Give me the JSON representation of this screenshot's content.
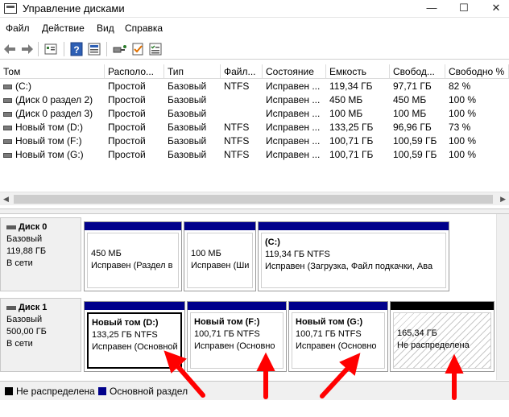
{
  "window": {
    "title": "Управление дисками",
    "minimize": "—",
    "maximize": "☐",
    "close": "✕"
  },
  "menu": [
    "Файл",
    "Действие",
    "Вид",
    "Справка"
  ],
  "toolbar_icons": [
    "back-icon",
    "forward-icon",
    "properties-icon",
    "help-icon",
    "view-icon",
    "connect-icon",
    "check-icon",
    "list-icon"
  ],
  "columns": [
    "Том",
    "Располо...",
    "Тип",
    "Файл...",
    "Состояние",
    "Емкость",
    "Свобод...",
    "Свободно %"
  ],
  "volumes": [
    [
      "(C:)",
      "Простой",
      "Базовый",
      "NTFS",
      "Исправен ...",
      "119,34 ГБ",
      "97,71 ГБ",
      "82 %"
    ],
    [
      "(Диск 0 раздел 2)",
      "Простой",
      "Базовый",
      "",
      "Исправен ...",
      "450 МБ",
      "450 МБ",
      "100 %"
    ],
    [
      "(Диск 0 раздел 3)",
      "Простой",
      "Базовый",
      "",
      "Исправен ...",
      "100 МБ",
      "100 МБ",
      "100 %"
    ],
    [
      "Новый том (D:)",
      "Простой",
      "Базовый",
      "NTFS",
      "Исправен ...",
      "133,25 ГБ",
      "96,96 ГБ",
      "73 %"
    ],
    [
      "Новый том (F:)",
      "Простой",
      "Базовый",
      "NTFS",
      "Исправен ...",
      "100,71 ГБ",
      "100,59 ГБ",
      "100 %"
    ],
    [
      "Новый том (G:)",
      "Простой",
      "Базовый",
      "NTFS",
      "Исправен ...",
      "100,71 ГБ",
      "100,59 ГБ",
      "100 %"
    ]
  ],
  "disks": [
    {
      "name": "Диск 0",
      "type": "Базовый",
      "size": "119,88 ГБ",
      "status": "В сети",
      "partitions": [
        {
          "name": "",
          "size": "450 МБ",
          "status": "Исправен (Раздел в"
        },
        {
          "name": "",
          "size": "100 МБ",
          "status": "Исправен (Ши"
        },
        {
          "name": "(C:)",
          "size": "119,34 ГБ NTFS",
          "status": "Исправен (Загрузка, Файл подкачки, Ава"
        }
      ]
    },
    {
      "name": "Диск 1",
      "type": "Базовый",
      "size": "500,00 ГБ",
      "status": "В сети",
      "partitions": [
        {
          "name": "Новый том  (D:)",
          "size": "133,25 ГБ NTFS",
          "status": "Исправен (Основной"
        },
        {
          "name": "Новый том  (F:)",
          "size": "100,71 ГБ NTFS",
          "status": "Исправен (Основно"
        },
        {
          "name": "Новый том  (G:)",
          "size": "100,71 ГБ NTFS",
          "status": "Исправен (Основно"
        },
        {
          "name": "",
          "size": "165,34 ГБ",
          "status": "Не распределена"
        }
      ]
    }
  ],
  "legend": [
    {
      "label": "Не распределена",
      "color": "#000000"
    },
    {
      "label": "Основной раздел",
      "color": "#00008b"
    }
  ],
  "colors": {
    "primary_partition": "#00008b",
    "unallocated": "#000000",
    "annotation_arrow": "#ff0000"
  }
}
